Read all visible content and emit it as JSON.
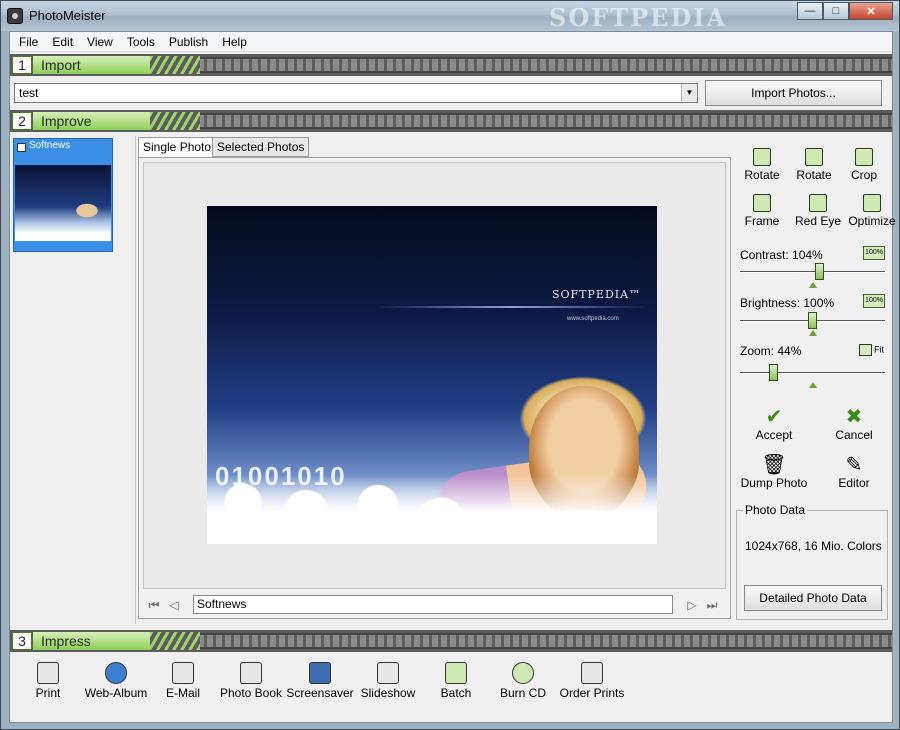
{
  "window": {
    "title": "PhotoMeister",
    "watermark": "SOFTPEDIA",
    "minimize": "—",
    "maximize": "□",
    "close": "✕"
  },
  "menu": [
    "File",
    "Edit",
    "View",
    "Tools",
    "Publish",
    "Help"
  ],
  "sections": {
    "import": {
      "num": "1",
      "label": "Import"
    },
    "improve": {
      "num": "2",
      "label": "Improve"
    },
    "impress": {
      "num": "3",
      "label": "Impress"
    }
  },
  "import": {
    "combo_value": "test",
    "button": "Import Photos..."
  },
  "thumbnails": [
    {
      "name": "Softnews",
      "selected": true
    }
  ],
  "tabs": [
    "Single Photo",
    "Selected Photos"
  ],
  "photo": {
    "brand": "SOFTPEDIA™",
    "url": "www.softpedia.com",
    "digits": "01001010"
  },
  "viewer": {
    "photo_name": "Softnews"
  },
  "tools": {
    "top": [
      "Rotate",
      "Rotate",
      "Crop"
    ],
    "row2": [
      "Frame",
      "Red Eye",
      "Optimize"
    ],
    "contrast": {
      "label": "Contrast: 104%",
      "value": 104
    },
    "brightness": {
      "label": "Brightness: 100%",
      "value": 100
    },
    "zoom": {
      "label": "Zoom: 44%",
      "value": 44
    },
    "pct_button": "100%",
    "fit": "Fit",
    "accept": "Accept",
    "cancel": "Cancel",
    "dump": "Dump Photo",
    "editor": "Editor",
    "photo_data": {
      "legend": "Photo Data",
      "info": "1024x768, 16 Mio. Colors",
      "button": "Detailed Photo Data"
    }
  },
  "impress": [
    "Print",
    "Web-Album",
    "E-Mail",
    "Photo Book",
    "Screensaver",
    "Slideshow",
    "Batch",
    "Burn CD",
    "Order Prints"
  ],
  "colors": {
    "accent_green": "#8fcf5a",
    "selection_blue": "#3b8fe6",
    "film_gray": "#5c5c5c"
  }
}
